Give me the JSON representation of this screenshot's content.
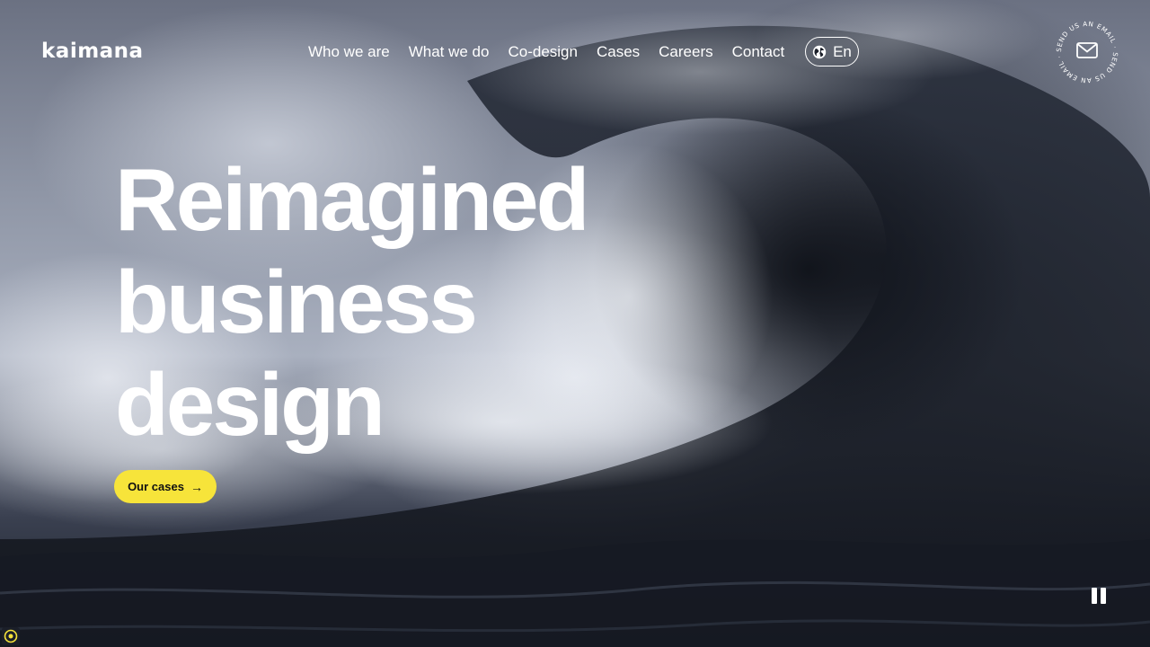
{
  "brand": {
    "logo": "kaimana"
  },
  "nav": {
    "items": [
      {
        "label": "Who we are"
      },
      {
        "label": "What we do"
      },
      {
        "label": "Co-design"
      },
      {
        "label": "Cases"
      },
      {
        "label": "Careers"
      },
      {
        "label": "Contact"
      }
    ],
    "language": {
      "label": "En",
      "icon": "globe-icon"
    }
  },
  "email_badge": {
    "text": "SEND US AN EMAIL · SEND US AN EMAIL ·",
    "icon": "envelope-icon"
  },
  "hero": {
    "headline_lines": [
      "Reimagined",
      "business",
      "design"
    ],
    "cta_label": "Our cases",
    "cta_icon": "arrow-right-icon",
    "accent_color": "#f7e43a"
  },
  "media_controls": {
    "icon": "pause-icon"
  }
}
